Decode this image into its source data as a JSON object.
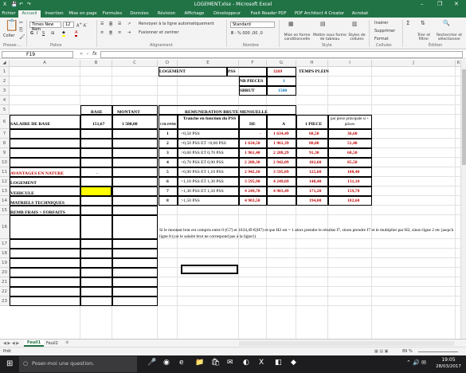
{
  "titlebar": {
    "title": "LOGEMENT.xlsx - Microsoft Excel",
    "save": "💾",
    "undo": "↶",
    "redo": "↷"
  },
  "tabs": [
    "Fichier",
    "Accueil",
    "Insertion",
    "Mise en page",
    "Formules",
    "Données",
    "Révision",
    "Affichage",
    "Développeur",
    "Foxit Reader PDF",
    "PDF Architect 4 Creator",
    "Acrobat"
  ],
  "active_tab": "Accueil",
  "ribbon": {
    "paste": "Coller",
    "font_name": "Times New Rom",
    "font_size": "12",
    "wrap": "Renvoyer à la ligne automatiquement",
    "merge": "Fusionner et centrer",
    "number_format": "Standard",
    "cond_format": "Mise en forme conditionnelle",
    "table_format": "Mettre sous forme de tableau",
    "cell_styles": "Styles de cellules",
    "insert": "Insérer",
    "delete": "Supprimer",
    "format": "Format",
    "sort": "Trier et filtrer",
    "find": "Rechercher et sélectionner",
    "groups": {
      "clipboard": "Presse-...",
      "font": "Police",
      "alignment": "Alignement",
      "number": "Nombre",
      "styles": "Style",
      "cells": "Cellules",
      "edition": "Édition"
    }
  },
  "formula_bar": {
    "name_box": "F19",
    "fx": "fx",
    "formula": ""
  },
  "columns": [
    "A",
    "B",
    "C",
    "D",
    "E",
    "F",
    "G",
    "H",
    "I",
    "J",
    "K",
    "L"
  ],
  "rows": [
    "1",
    "2",
    "3",
    "4",
    "5",
    "6",
    "7",
    "8",
    "9",
    "10",
    "11",
    "12",
    "13",
    "14",
    "15",
    "16",
    "17",
    "18",
    "19",
    "20",
    "21",
    "22",
    "23"
  ],
  "cells": {
    "d1": "LOGEMENT",
    "g1": "PSS",
    "h1": "3269",
    "i1": "TEMPS PLEIN",
    "g2": "NB PIECES",
    "h2": "1",
    "g3": "SBRUT",
    "h3": "1500",
    "b4": "BASE",
    "c4": "MONTANT",
    "e5": "REMUNERATION BRUTE MENSUELLE",
    "a6": "SALAIRE DE BASE",
    "b6": "151,67",
    "c6": "1 500,00",
    "e6": "COLONNE",
    "f6": "Tranche en fonction du PSS",
    "g6": "DE",
    "h6": "A",
    "i6": "1 PIECE",
    "j6": "par pièce principale si + pièces",
    "a11": "AVANTAGES EN NATURE",
    "b11": "-",
    "a12": "LOGEMENT",
    "a13": "VEHICULE",
    "a14": "MATRIELS TECHNIQUES",
    "a15": "REMB FRAIS > FORFAITS",
    "note": "Si le montant brut est compris entre 0 (G7) et 1634,49 €(H7)  et que H2 est = 1 alors prendre le résultat I7, sinon prendre J7 et le multiplier par H2, sinon ligne 2 etc jusqu'à ligne 8 (car le salaire brut ne correspond pas à la ligne1)"
  },
  "bareme": [
    {
      "col": "1",
      "tranche": "<0,50 PSS",
      "de": "-",
      "a": "1 634,49",
      "p1": "68,50",
      "pp": "36,60"
    },
    {
      "col": "2",
      "tranche": ">0,50 PSS ET <0,60 PSS",
      "de": "1 634,50",
      "a": "1 961,39",
      "p1": "80,00",
      "pp": "51,40"
    },
    {
      "col": "3",
      "tranche": ">0,60 PSS ET 0,70 PSS",
      "de": "1 961,40",
      "a": "2 288,29",
      "p1": "91,30",
      "pp": "68,50"
    },
    {
      "col": "4",
      "tranche": ">0,70 PSS ET 0,90 PSS",
      "de": "2 288,30",
      "a": "2 942,09",
      "p1": "102,60",
      "pp": "85,50"
    },
    {
      "col": "5",
      "tranche": ">0,90 PSS ET 1,10 PSS",
      "de": "2 942,10",
      "a": "3 595,89",
      "p1": "125,60",
      "pp": "108,40"
    },
    {
      "col": "6",
      "tranche": ">1,10 PSS ET 1,30 PSS",
      "de": "3 595,90",
      "a": "4 249,69",
      "p1": "148,40",
      "pp": "131,10"
    },
    {
      "col": "7",
      "tranche": ">1,30 PSS ET 1,50 PSS",
      "de": "4 249,70",
      "a": "4 903,49",
      "p1": "171,20",
      "pp": "159,70"
    },
    {
      "col": "8",
      "tranche": ">1,50 PSS",
      "de": "4 903,50",
      "a": "",
      "p1": "194,00",
      "pp": "182,60"
    }
  ],
  "sheets": [
    "Feuil1",
    "Feuil2"
  ],
  "status": {
    "ready": "Prêt",
    "zoom": "89 %"
  },
  "taskbar": {
    "search": "Poser-moi une question.",
    "time": "19:05",
    "date": "28/03/2017"
  },
  "colors": {
    "excel_green": "#217346",
    "red": "#c00000",
    "blue": "#0070c0",
    "yellow": "#ffff00"
  }
}
